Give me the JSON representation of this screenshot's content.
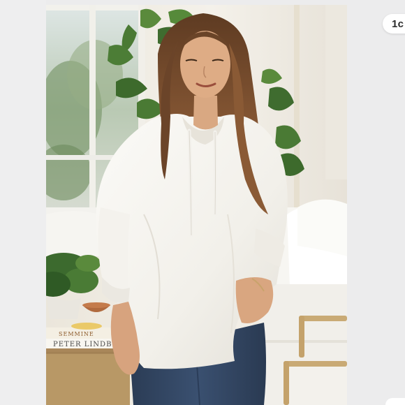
{
  "photo": {
    "book_titles": [
      "SEMMINE",
      "PETER LINDB"
    ]
  },
  "next_chip": {
    "label": "1c"
  },
  "colors": {
    "page_background": "#ececed",
    "hoodie": "#f6f5f1",
    "hair": "#7b4f31",
    "jeans": "#33455f",
    "foliage": "#3f6c2f"
  }
}
